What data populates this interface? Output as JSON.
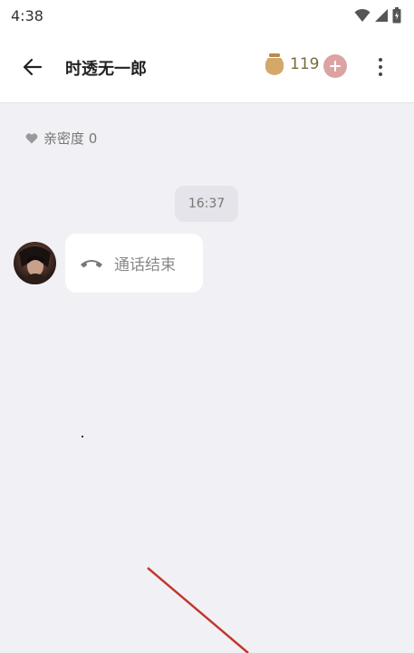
{
  "status_bar": {
    "time": "4:38",
    "icons": [
      "wifi-icon",
      "signal-icon",
      "battery-icon"
    ]
  },
  "app_bar": {
    "back_icon": "arrow-left-icon",
    "title": "时透无一郎",
    "coin_icon": "coin-jar-icon",
    "coin_count": "119",
    "add_icon": "plus-icon",
    "more_icon": "more-vertical-icon"
  },
  "intimacy": {
    "icon": "heart-icon",
    "label": "亲密度 0"
  },
  "messages": [
    {
      "timestamp": "16:37",
      "sender_avatar": "avatar",
      "icon": "phone-hangup-icon",
      "text": "通话结束"
    }
  ],
  "colors": {
    "background": "#f1f1f5",
    "app_bar": "#ffffff",
    "add_button": "#dca3a3",
    "coin": "#c9a36b",
    "annotation_line": "#c0392b"
  }
}
